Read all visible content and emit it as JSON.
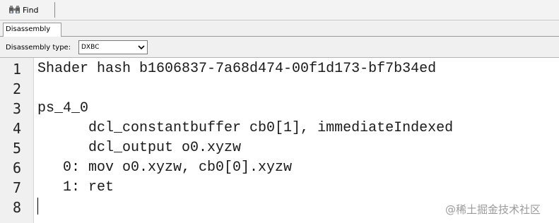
{
  "toolbar": {
    "find_label": "Find"
  },
  "tabs": [
    {
      "label": "Disassembly"
    }
  ],
  "disassembly_type": {
    "label": "Disassembly type:",
    "selected": "DXBC"
  },
  "editor": {
    "lines": [
      {
        "number": "1",
        "text": "Shader hash b1606837-7a68d474-00f1d173-bf7b34ed"
      },
      {
        "number": "2",
        "text": ""
      },
      {
        "number": "3",
        "text": "ps_4_0"
      },
      {
        "number": "4",
        "text": "      dcl_constantbuffer cb0[1], immediateIndexed"
      },
      {
        "number": "5",
        "text": "      dcl_output o0.xyzw"
      },
      {
        "number": "6",
        "text": "   0: mov o0.xyzw, cb0[0].xyzw"
      },
      {
        "number": "7",
        "text": "   1: ret"
      },
      {
        "number": "8",
        "text": ""
      }
    ]
  },
  "watermark": "@稀土掘金技术社区"
}
